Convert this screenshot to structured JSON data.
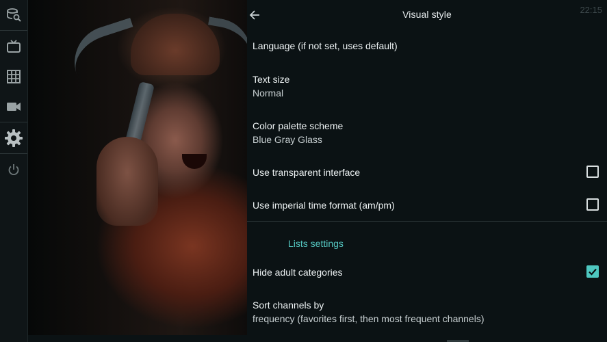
{
  "sidebar": {
    "items": [
      {
        "icon": "search-database-icon"
      },
      {
        "icon": "tv-icon"
      },
      {
        "icon": "grid-icon"
      },
      {
        "icon": "video-camera-icon"
      },
      {
        "icon": "gear-icon",
        "active": true
      },
      {
        "icon": "power-icon"
      }
    ]
  },
  "header": {
    "title": "Visual style",
    "clock": "22:15"
  },
  "settings": {
    "language": {
      "label": "Language (if not set, uses default)"
    },
    "text_size": {
      "label": "Text size",
      "value": "Normal"
    },
    "color_palette": {
      "label": "Color palette scheme",
      "value": "Blue Gray Glass"
    },
    "transparent_ui": {
      "label": "Use transparent interface",
      "checked": false
    },
    "imperial_time": {
      "label": "Use imperial time format (am/pm)",
      "checked": false
    },
    "lists_section": {
      "title": "Lists settings"
    },
    "hide_adult": {
      "label": "Hide adult categories",
      "checked": true
    },
    "sort_channels": {
      "label": "Sort channels by",
      "value": "frequency (favorites first, then most frequent channels)"
    }
  },
  "colors": {
    "accent": "#4ec7c0",
    "background": "#0b1214",
    "rail": "#0f1517",
    "text": "#e9eef0",
    "clock": "#3f4a4d"
  }
}
